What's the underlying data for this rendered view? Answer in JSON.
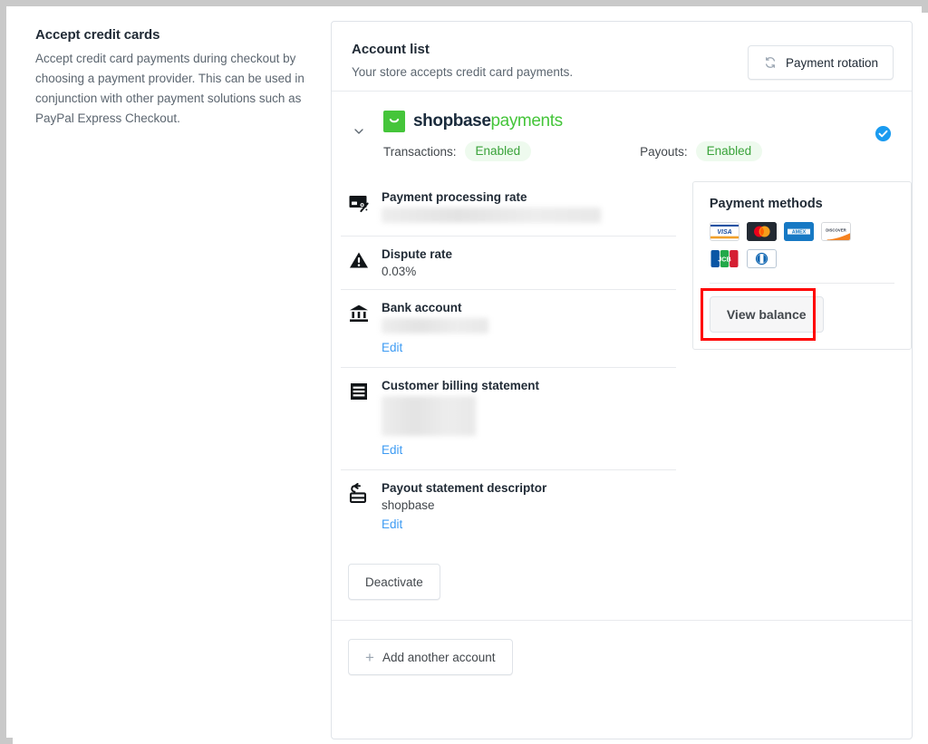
{
  "left": {
    "title": "Accept credit cards",
    "description": "Accept credit card payments during checkout by choosing a payment provider. This can be used in conjunction with other payment solutions such as PayPal Express Checkout."
  },
  "card": {
    "title": "Account list",
    "subtitle": "Your store accepts credit card payments.",
    "rotation_button": "Payment rotation",
    "rotation_icon": "rotate-icon"
  },
  "account": {
    "chevron_icon": "chevron-down-icon",
    "brand_name_bold": "shopbase",
    "brand_name_light": "payments",
    "brand_icon": "shopbase-logo-icon",
    "verified_icon": "verified-check-icon",
    "transactions_label": "Transactions:",
    "transactions_status": "Enabled",
    "payouts_label": "Payouts:",
    "payouts_status": "Enabled",
    "rows": [
      {
        "icon": "card-percent-icon",
        "title": "Payment processing rate",
        "value": "",
        "redacted": true,
        "edit": ""
      },
      {
        "icon": "warning-triangle-icon",
        "title": "Dispute rate",
        "value": "0.03%",
        "redacted": false,
        "edit": ""
      },
      {
        "icon": "bank-icon",
        "title": "Bank account",
        "value": "",
        "redacted": true,
        "edit": "Edit"
      },
      {
        "icon": "receipt-icon",
        "title": "Customer billing statement",
        "value": "",
        "redacted": true,
        "edit": "Edit"
      },
      {
        "icon": "payout-card-icon",
        "title": "Payout statement descriptor",
        "value": "shopbase",
        "redacted": false,
        "edit": "Edit"
      }
    ],
    "deactivate_button": "Deactivate"
  },
  "methods": {
    "title": "Payment methods",
    "cards": [
      {
        "name": "visa-card-icon",
        "label": "VISA"
      },
      {
        "name": "mastercard-card-icon",
        "label": ""
      },
      {
        "name": "amex-card-icon",
        "label": "AMEX"
      },
      {
        "name": "discover-card-icon",
        "label": "DISCOVER"
      },
      {
        "name": "jcb-card-icon",
        "label": "JCB"
      },
      {
        "name": "diners-club-card-icon",
        "label": ""
      }
    ],
    "balance_button": "View balance"
  },
  "footer": {
    "add_account_button": "Add another account",
    "add_icon": "plus-icon"
  },
  "colors": {
    "brand_green": "#45c53a",
    "status_green": "#3aa33a",
    "status_green_bg": "#eefaee",
    "link_blue": "#3d9bf3",
    "verified_blue": "#1a9bf0",
    "highlight_red": "#ff0000",
    "border_gray": "#dfe3e8"
  }
}
